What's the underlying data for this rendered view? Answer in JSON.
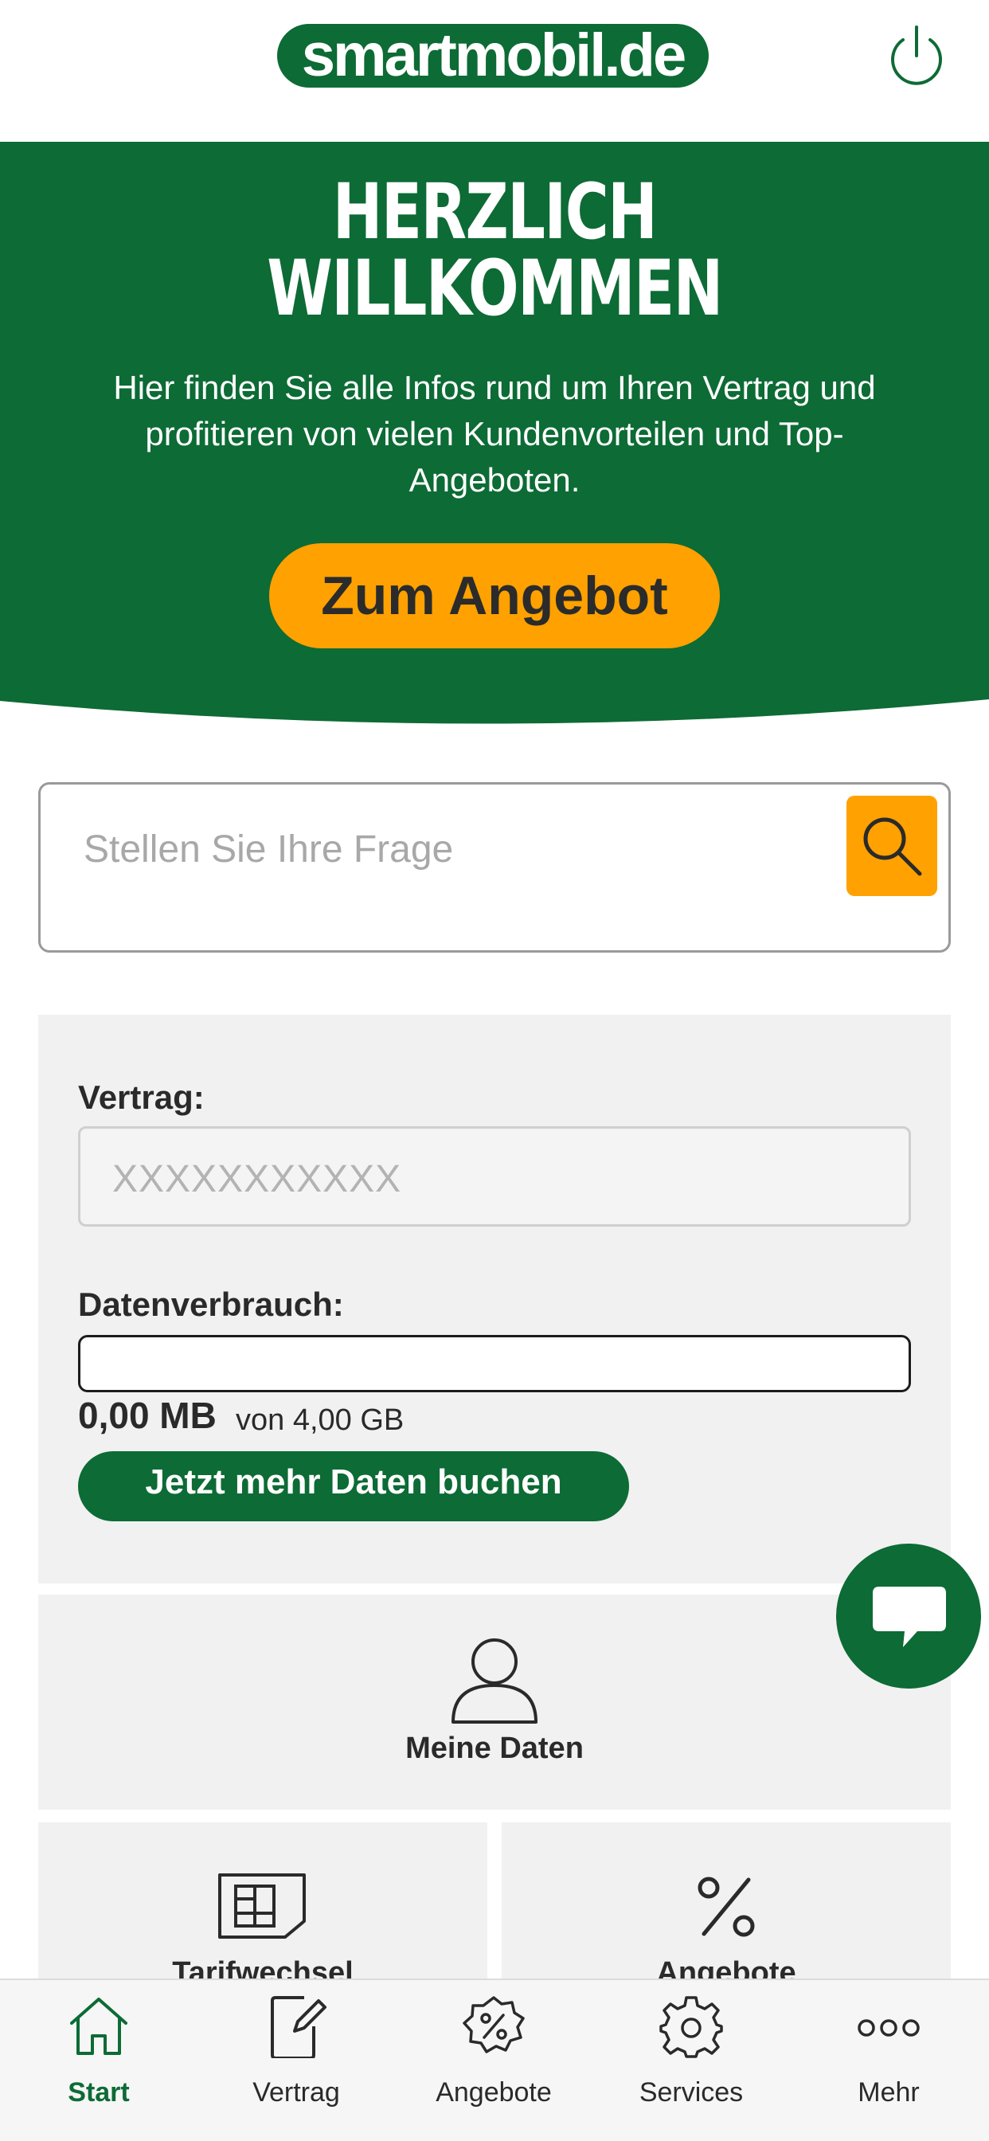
{
  "header": {
    "logo_text": "smartmobil.de",
    "power_icon": "power-icon"
  },
  "hero": {
    "title_line1": "HERZLICH",
    "title_line2": "WILLKOMMEN",
    "text": "Hier finden Sie alle Infos rund um Ihren Vertrag und profitieren von vielen Kundenvorteilen und Top-Angeboten.",
    "button_label": "Zum Angebot"
  },
  "search": {
    "placeholder": "Stellen Sie Ihre Frage",
    "icon": "search-icon"
  },
  "contract": {
    "label": "Vertrag:",
    "number": "XXXXXXXXXXX",
    "usage_label": "Datenverbrauch:",
    "usage_used": "0,00 MB",
    "usage_total": "von 4,00 GB",
    "usage_fraction": 0,
    "book_button": "Jetzt mehr Daten buchen"
  },
  "tiles": [
    {
      "label": "Meine Daten",
      "icon": "person-icon"
    },
    {
      "label": "Tarifwechsel",
      "icon": "sim-card-icon"
    },
    {
      "label": "Angebote",
      "icon": "percent-icon"
    }
  ],
  "chat": {
    "icon": "chat-bubble-icon"
  },
  "tabbar": {
    "items": [
      {
        "label": "Start",
        "icon": "home-icon",
        "active": true
      },
      {
        "label": "Vertrag",
        "icon": "contract-edit-icon",
        "active": false
      },
      {
        "label": "Angebote",
        "icon": "percent-badge-icon",
        "active": false
      },
      {
        "label": "Services",
        "icon": "gear-icon",
        "active": false
      },
      {
        "label": "Mehr",
        "icon": "more-dots-icon",
        "active": false
      }
    ]
  },
  "colors": {
    "brand_green": "#0d6b35",
    "accent_orange": "#ffa100",
    "card_gray": "#f1f1f1"
  }
}
